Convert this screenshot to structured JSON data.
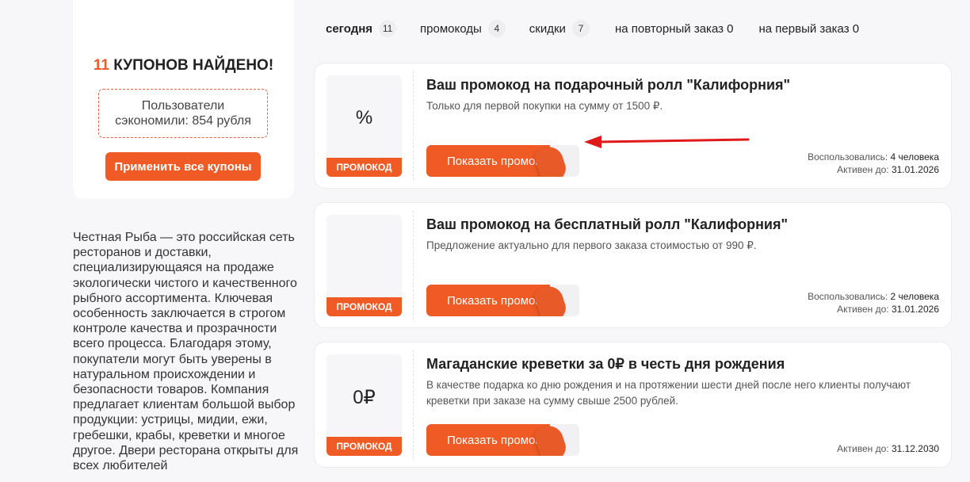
{
  "summary": {
    "count": "11",
    "title_rest": "КУПОНОВ НАЙДЕНО!",
    "saved_line1": "Пользователи",
    "saved_line2": "сэкономили: 854 рубля",
    "apply_label": "Применить все купоны"
  },
  "about": "Честная Рыба — это российская сеть ресторанов и доставки, специализирующаяся на продаже экологически чистого и качественного рыбного ассортимента. Ключевая особенность заключается в строгом контроле качества и прозрачности всего процесса. Благодаря этому, покупатели могут быть уверены в натуральном происхождении и безопасности товаров. Компания предлагает клиентам большой выбор продукции: устрицы, мидии, ежи, гребешки, крабы, креветки и многое другое. Двери ресторана открыты для всех любителей",
  "tabs": [
    {
      "label": "сегодня",
      "badge": "11",
      "active": true
    },
    {
      "label": "промокоды",
      "badge": "4"
    },
    {
      "label": "скидки",
      "badge": "7"
    },
    {
      "label": "на повторный заказ 0"
    },
    {
      "label": "на первый заказ 0"
    }
  ],
  "coupons": [
    {
      "glyph": "%",
      "tag": "ПРОМОКОД",
      "title": "Ваш промокод на подарочный ролл \"Калифорния\"",
      "desc": "Только для первой покупки на сумму от 1500 ₽.",
      "button": "Показать промокод",
      "used_label": "Воспользовались:",
      "used_value": "4 человека",
      "active_label": "Активен до:",
      "active_value": "31.01.2026"
    },
    {
      "glyph": "",
      "tag": "ПРОМОКОД",
      "title": "Ваш промокод на бесплатный ролл \"Калифорния\"",
      "desc": "Предложение актуально для первого заказа стоимостью от 990 ₽.",
      "button": "Показать промокод",
      "used_label": "Воспользовались:",
      "used_value": "2 человека",
      "active_label": "Активен до:",
      "active_value": "31.01.2026"
    },
    {
      "glyph": "0₽",
      "tag": "ПРОМОКОД",
      "title": "Магаданские креветки за 0₽ в честь дня рождения",
      "desc": "В качестве подарка ко дню рождения и на протяжении шести дней после него клиенты получают креветки при заказе на сумму свыше 2500 рублей.",
      "button": "Показать промокод",
      "active_label": "Активен до:",
      "active_value": "31.12.2030"
    }
  ],
  "colors": {
    "accent": "#f05a24",
    "arrow": "#e0191b"
  }
}
